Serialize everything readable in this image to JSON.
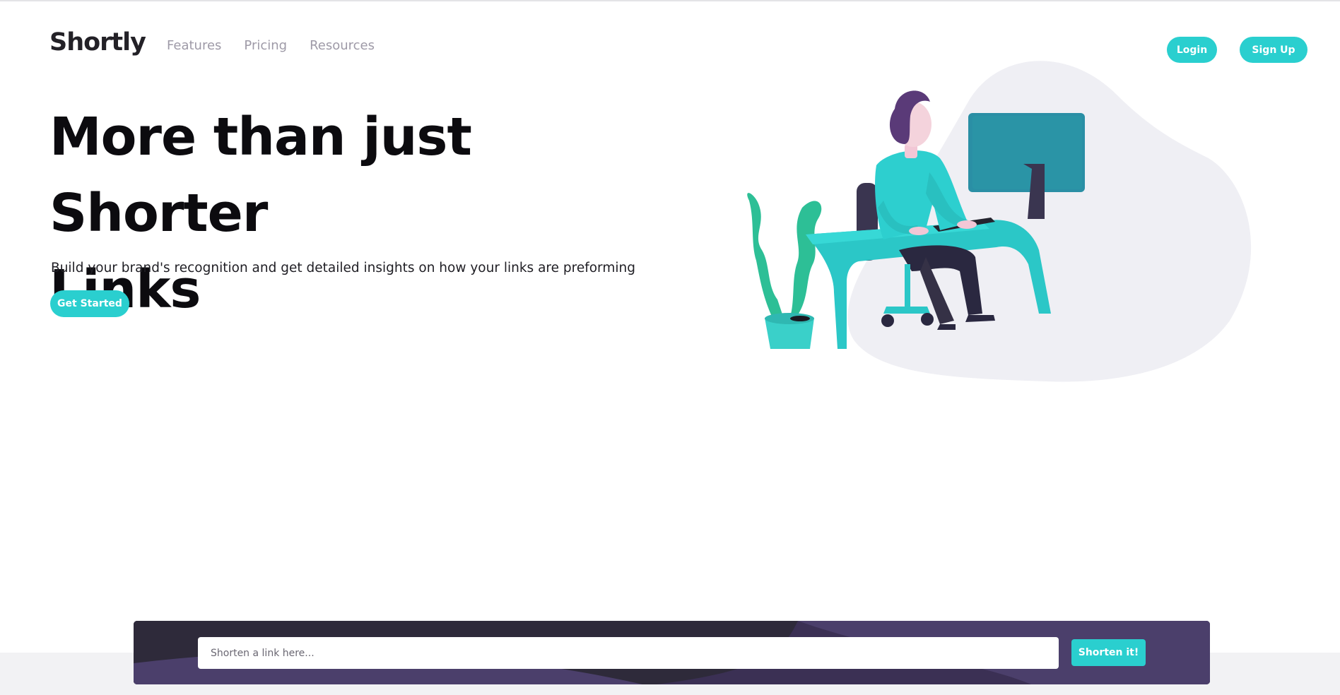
{
  "header": {
    "logo": "Shortly",
    "nav": [
      "Features",
      "Pricing",
      "Resources"
    ],
    "login_label": "Login",
    "signup_label": "Sign Up"
  },
  "hero": {
    "title_line1": "More than just Shorter",
    "title_line2": "Links",
    "subtitle": "Build your brand's recognition and get detailed insights on how your links are preforming",
    "cta_label": "Get Started"
  },
  "shorten": {
    "placeholder": "Shorten a link here...",
    "button_label": "Shorten it!"
  },
  "colors": {
    "accent": "#2acfcf",
    "dark_violet": "#3b3054",
    "heading": "#0c0b0f",
    "nav_text": "#9e9aa7"
  },
  "icons": {
    "illustration": "person-working-illustration"
  }
}
